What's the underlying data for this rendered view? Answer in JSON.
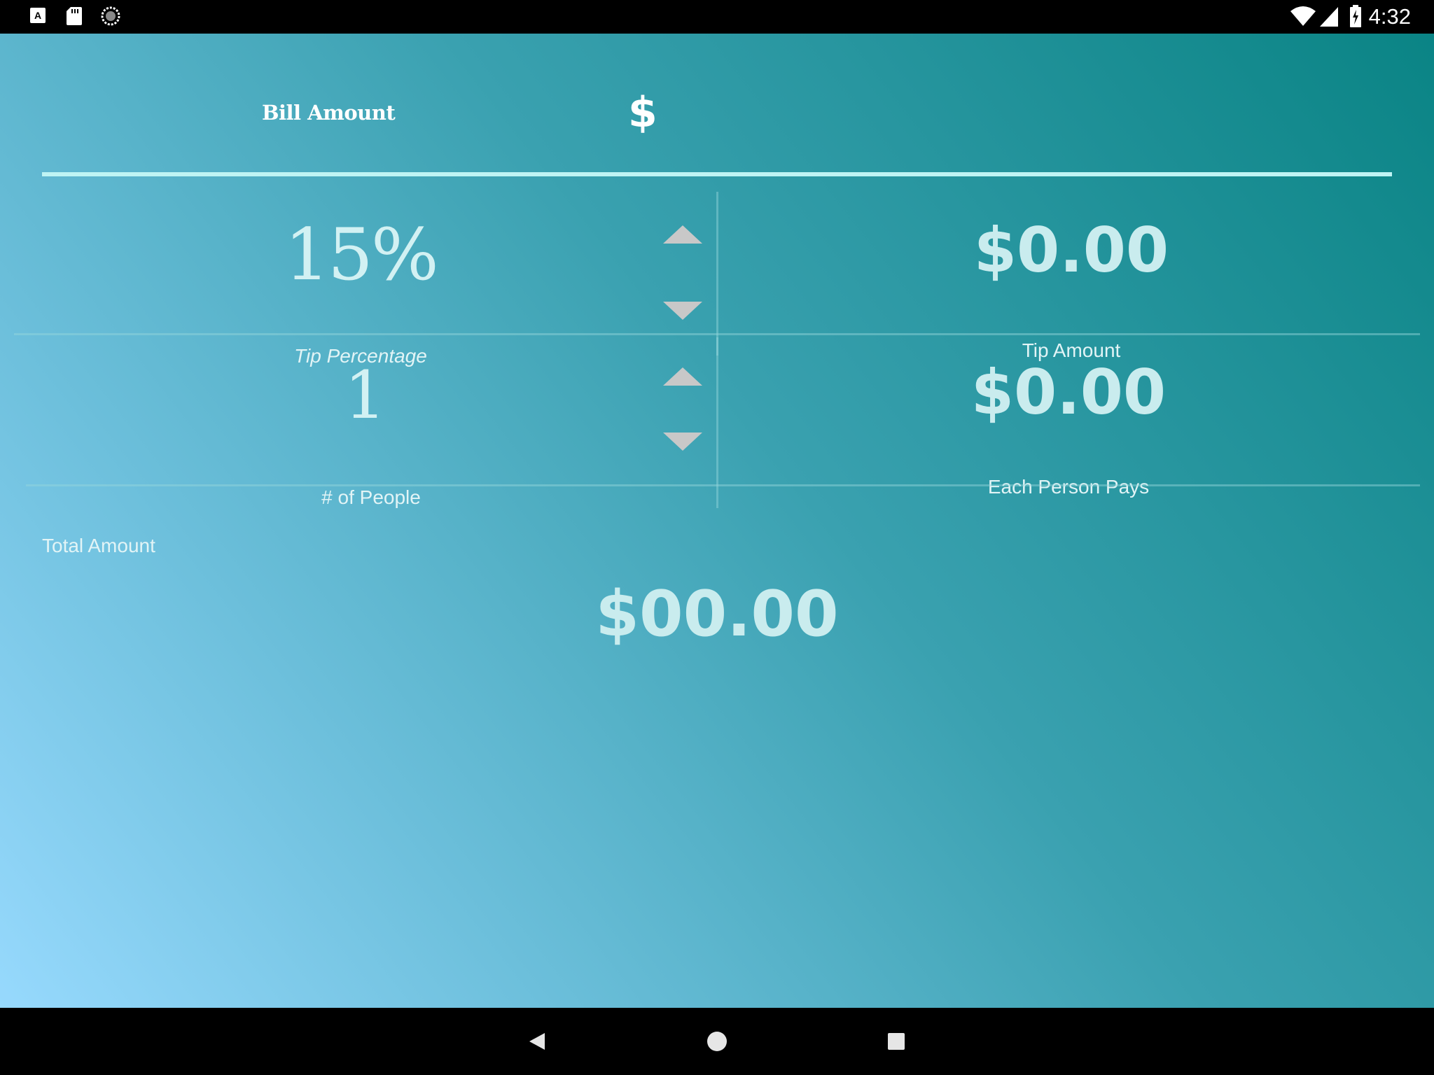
{
  "status_bar": {
    "time": "4:32",
    "left_icons": [
      "keyboard-a-icon",
      "sd-card-icon",
      "loading-circle-icon"
    ],
    "right_icons": [
      "wifi-icon",
      "signal-icon",
      "battery-charging-icon"
    ]
  },
  "bill": {
    "label": "Bill Amount",
    "currency_symbol": "$",
    "value": "",
    "placeholder": ""
  },
  "tip": {
    "percentage": "15%",
    "percentage_label": "Tip Percentage",
    "amount": "$0.00",
    "amount_label": "Tip Amount"
  },
  "people": {
    "count": "1",
    "count_label": "# of People",
    "each_pays": "$0.00",
    "each_pays_label": "Each Person Pays"
  },
  "total": {
    "label": "Total Amount",
    "value": "$00.00"
  },
  "nav_bar": {
    "buttons": [
      "back-icon",
      "home-icon",
      "recents-icon"
    ]
  },
  "colors": {
    "gradient_top_right": "#0a8485",
    "gradient_bottom_left": "#97d9fd",
    "value_text": "#c9ecee",
    "arrow": "#c8c8c8",
    "underline": "#bff4f4"
  }
}
